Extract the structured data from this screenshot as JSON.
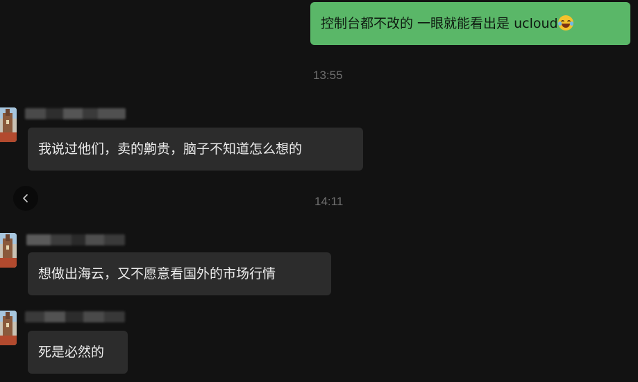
{
  "messages": {
    "outgoing_1": "控制台都不改的  一眼就能看出是 ucloud",
    "incoming_1": "我说过他们，卖的齁贵，脑子不知道怎么想的",
    "incoming_2": "想做出海云，又不愿意看国外的市场行情",
    "incoming_3": "死是必然的"
  },
  "timestamps": {
    "t1": "13:55",
    "t2": "14:11"
  },
  "icons": {
    "back": "chevron-left-icon",
    "emoji": "tears-of-joy-emoji"
  },
  "colors": {
    "background": "#121212",
    "outgoing_bubble": "#5ab768",
    "incoming_bubble": "#2c2c2c",
    "timestamp": "#6f6f6f"
  }
}
